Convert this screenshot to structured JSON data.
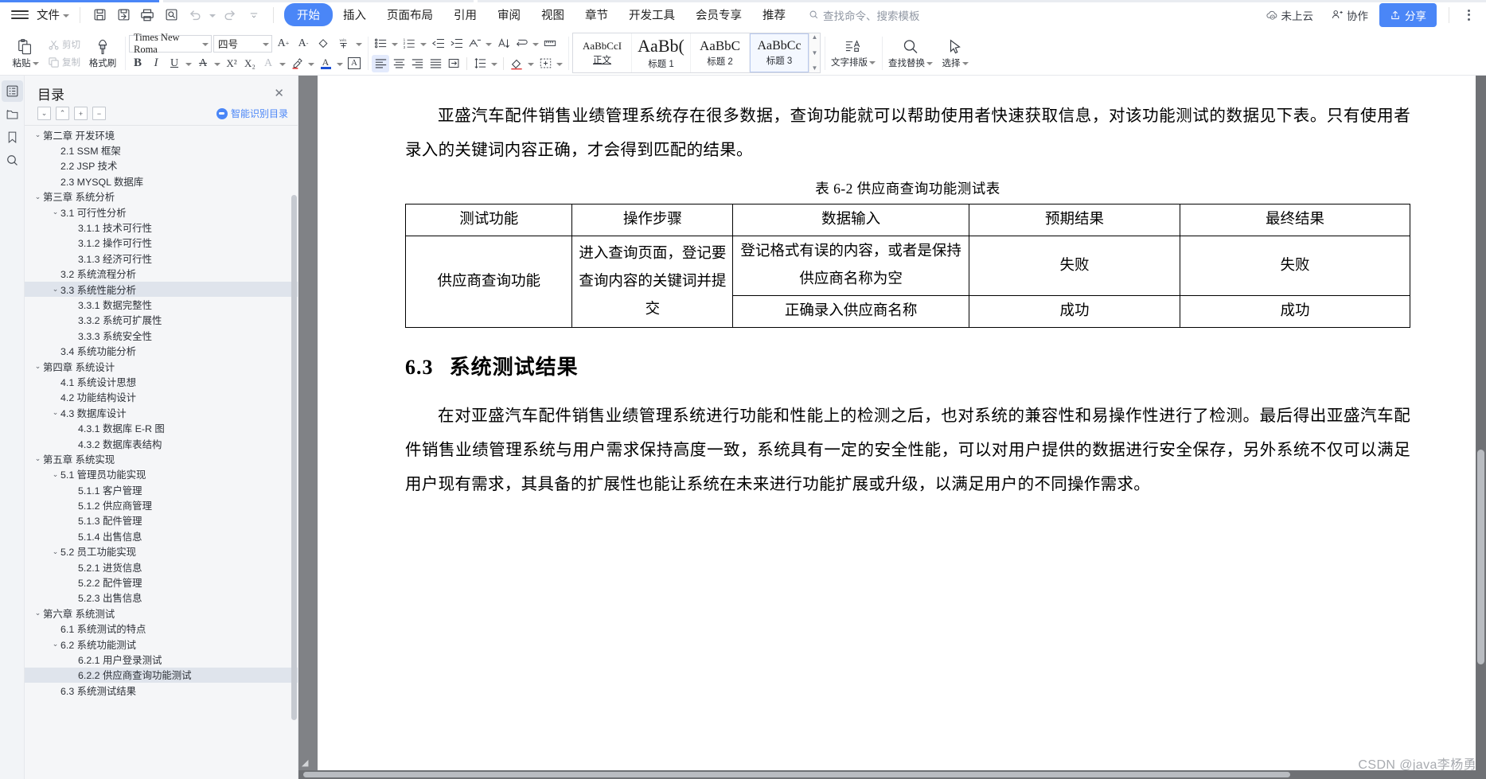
{
  "menubar": {
    "file_label": "文件",
    "quick_icons": [
      "save-icon",
      "save-as-icon",
      "print-icon",
      "print-preview-icon",
      "undo-icon",
      "redo-icon",
      "customize-icon"
    ],
    "tabs": [
      {
        "label": "开始",
        "active": true
      },
      {
        "label": "插入",
        "active": false
      },
      {
        "label": "页面布局",
        "active": false
      },
      {
        "label": "引用",
        "active": false
      },
      {
        "label": "审阅",
        "active": false
      },
      {
        "label": "视图",
        "active": false
      },
      {
        "label": "章节",
        "active": false
      },
      {
        "label": "开发工具",
        "active": false
      },
      {
        "label": "会员专享",
        "active": false
      },
      {
        "label": "推荐",
        "active": false
      }
    ],
    "search_placeholder": "查找命令、搜索模板",
    "cloud_status": "未上云",
    "collab_label": "协作",
    "share_label": "分享"
  },
  "ribbon": {
    "clipboard": {
      "paste": "粘贴",
      "cut": "剪切",
      "copy": "复制",
      "format_painter": "格式刷"
    },
    "font": {
      "family_value": "Times New Roma",
      "size_value": "四号",
      "grow_label": "A+",
      "shrink_label": "A-",
      "clear_format": "clear-format-icon",
      "pinyin_guide": "pinyin-guide-icon",
      "bold": "B",
      "italic": "I",
      "underline": "U",
      "strikethrough": "A",
      "superscript": "X²",
      "subscript": "X₂",
      "char_shading": "A",
      "highlight": "highlight-icon",
      "font_color": "A",
      "char_border": "A"
    },
    "paragraph": {
      "bullets": "bullet-list-icon",
      "numbering": "numbered-list-icon",
      "decrease_indent": "decrease-indent-icon",
      "increase_indent": "increase-indent-icon",
      "multilevel": "multilevel-list-icon",
      "sort": "sort-icon",
      "show_marks": "show-marks-icon",
      "ruler": "ruler-icon",
      "align_left": "align-left-icon",
      "align_center": "align-center-icon",
      "align_right": "align-right-icon",
      "align_justify": "align-justify-icon",
      "distribute": "distribute-icon",
      "line_spacing": "line-spacing-icon",
      "shading": "shading-icon",
      "borders": "borders-icon"
    },
    "styles": [
      {
        "preview": "AaBbCcI",
        "name": "正文",
        "size": "13px",
        "selected": false,
        "underline": true
      },
      {
        "preview": "AaBb(",
        "name": "标题 1",
        "size": "22px",
        "selected": false,
        "underline": false
      },
      {
        "preview": "AaBbC",
        "name": "标题 2",
        "size": "17px",
        "selected": false,
        "underline": false
      },
      {
        "preview": "AaBbCc",
        "name": "标题 3",
        "size": "16px",
        "selected": true,
        "underline": false
      }
    ],
    "text_layout": "文字排版",
    "find_replace": "查找替换",
    "select": "选择"
  },
  "sidebar_rail": [
    {
      "name": "outline-icon",
      "active": true
    },
    {
      "name": "folder-icon",
      "active": false
    },
    {
      "name": "bookmark-icon",
      "active": false
    },
    {
      "name": "search-icon",
      "active": false
    }
  ],
  "toc": {
    "title": "目录",
    "close_label": "✕",
    "tools": [
      "expand-down-button",
      "collapse-up-button",
      "expand-all-button",
      "collapse-all-button"
    ],
    "smart_label": "智能识别目录",
    "items": [
      {
        "label": "第二章  开发环境",
        "level": 0,
        "chevron": "down",
        "selected": false
      },
      {
        "label": "2.1 SSM 框架",
        "level": 1,
        "chevron": "none",
        "selected": false
      },
      {
        "label": "2.2 JSP 技术",
        "level": 1,
        "chevron": "none",
        "selected": false
      },
      {
        "label": "2.3 MYSQL 数据库",
        "level": 1,
        "chevron": "none",
        "selected": false
      },
      {
        "label": "第三章  系统分析",
        "level": 0,
        "chevron": "down",
        "selected": false
      },
      {
        "label": "3.1 可行性分析",
        "level": 1,
        "chevron": "down",
        "selected": false
      },
      {
        "label": "3.1.1 技术可行性",
        "level": 2,
        "chevron": "none",
        "selected": false
      },
      {
        "label": "3.1.2 操作可行性",
        "level": 2,
        "chevron": "none",
        "selected": false
      },
      {
        "label": "3.1.3 经济可行性",
        "level": 2,
        "chevron": "none",
        "selected": false
      },
      {
        "label": "3.2 系统流程分析",
        "level": 1,
        "chevron": "none",
        "selected": false
      },
      {
        "label": "3.3 系统性能分析",
        "level": 1,
        "chevron": "down",
        "selected": true
      },
      {
        "label": "3.3.1 数据完整性",
        "level": 2,
        "chevron": "none",
        "selected": false
      },
      {
        "label": "3.3.2 系统可扩展性",
        "level": 2,
        "chevron": "none",
        "selected": false
      },
      {
        "label": "3.3.3 系统安全性",
        "level": 2,
        "chevron": "none",
        "selected": false
      },
      {
        "label": "3.4 系统功能分析",
        "level": 1,
        "chevron": "none",
        "selected": false
      },
      {
        "label": "第四章  系统设计",
        "level": 0,
        "chevron": "down",
        "selected": false
      },
      {
        "label": "4.1  系统设计思想",
        "level": 1,
        "chevron": "none",
        "selected": false
      },
      {
        "label": "4.2 功能结构设计",
        "level": 1,
        "chevron": "none",
        "selected": false
      },
      {
        "label": "4.3 数据库设计",
        "level": 1,
        "chevron": "down",
        "selected": false
      },
      {
        "label": "4.3.1  数据库 E-R 图",
        "level": 2,
        "chevron": "none",
        "selected": false
      },
      {
        "label": "4.3.2  数据库表结构",
        "level": 2,
        "chevron": "none",
        "selected": false
      },
      {
        "label": "第五章  系统实现",
        "level": 0,
        "chevron": "down",
        "selected": false
      },
      {
        "label": "5.1 管理员功能实现",
        "level": 1,
        "chevron": "down",
        "selected": false
      },
      {
        "label": "5.1.1  客户管理",
        "level": 2,
        "chevron": "none",
        "selected": false
      },
      {
        "label": "5.1.2  供应商管理",
        "level": 2,
        "chevron": "none",
        "selected": false
      },
      {
        "label": "5.1.3  配件管理",
        "level": 2,
        "chevron": "none",
        "selected": false
      },
      {
        "label": "5.1.4  出售信息",
        "level": 2,
        "chevron": "none",
        "selected": false
      },
      {
        "label": "5.2 员工功能实现",
        "level": 1,
        "chevron": "down",
        "selected": false
      },
      {
        "label": "5.2.1  进货信息",
        "level": 2,
        "chevron": "none",
        "selected": false
      },
      {
        "label": "5.2.2  配件管理",
        "level": 2,
        "chevron": "none",
        "selected": false
      },
      {
        "label": "5.2.3  出售信息",
        "level": 2,
        "chevron": "none",
        "selected": false
      },
      {
        "label": "第六章  系统测试",
        "level": 0,
        "chevron": "down",
        "selected": false
      },
      {
        "label": "6.1 系统测试的特点",
        "level": 1,
        "chevron": "none",
        "selected": false
      },
      {
        "label": "6.2  系统功能测试",
        "level": 1,
        "chevron": "down",
        "selected": false
      },
      {
        "label": "6.2.1  用户登录测试",
        "level": 2,
        "chevron": "none",
        "selected": false
      },
      {
        "label": "6.2.2  供应商查询功能测试",
        "level": 2,
        "chevron": "none",
        "selected": true
      },
      {
        "label": "6.3 系统测试结果",
        "level": 1,
        "chevron": "none",
        "selected": false
      }
    ]
  },
  "document": {
    "paragraph1": "亚盛汽车配件销售业绩管理系统存在很多数据，查询功能就可以帮助使用者快速获取信息，对该功能测试的数据见下表。只有使用者录入的关键词内容正确，才会得到匹配的结果。",
    "table_caption": "表 6-2 供应商查询功能测试表",
    "table": {
      "headers": [
        "测试功能",
        "操作步骤",
        "数据输入",
        "预期结果",
        "最终结果"
      ],
      "rows": [
        {
          "col1": "供应商查询功能",
          "col2": "进入查询页面，登记要查询内容的关键词并提交",
          "cells": [
            {
              "input": "登记格式有误的内容，或者是保持供应商名称为空",
              "expected": "失败",
              "actual": "失败"
            },
            {
              "input": "正确录入供应商名称",
              "expected": "成功",
              "actual": "成功"
            }
          ]
        }
      ]
    },
    "heading_num": "6.3",
    "heading_text": "系统测试结果",
    "paragraph2": "在对亚盛汽车配件销售业绩管理系统进行功能和性能上的检测之后，也对系统的兼容性和易操作性进行了检测。最后得出亚盛汽车配件销售业绩管理系统与用户需求保持高度一致，系统具有一定的安全性能，可以对用户提供的数据进行安全保存，另外系统不仅可以满足用户现有需求，其具备的扩展性也能让系统在未来进行功能扩展或升级，以满足用户的不同操作需求。"
  },
  "watermark": "CSDN @java李杨勇",
  "colors": {
    "accent": "#4a86f7",
    "toc_bg": "#f5f6f8",
    "toc_selected": "#dfe4ec",
    "doc_bg": "#7f8184"
  }
}
